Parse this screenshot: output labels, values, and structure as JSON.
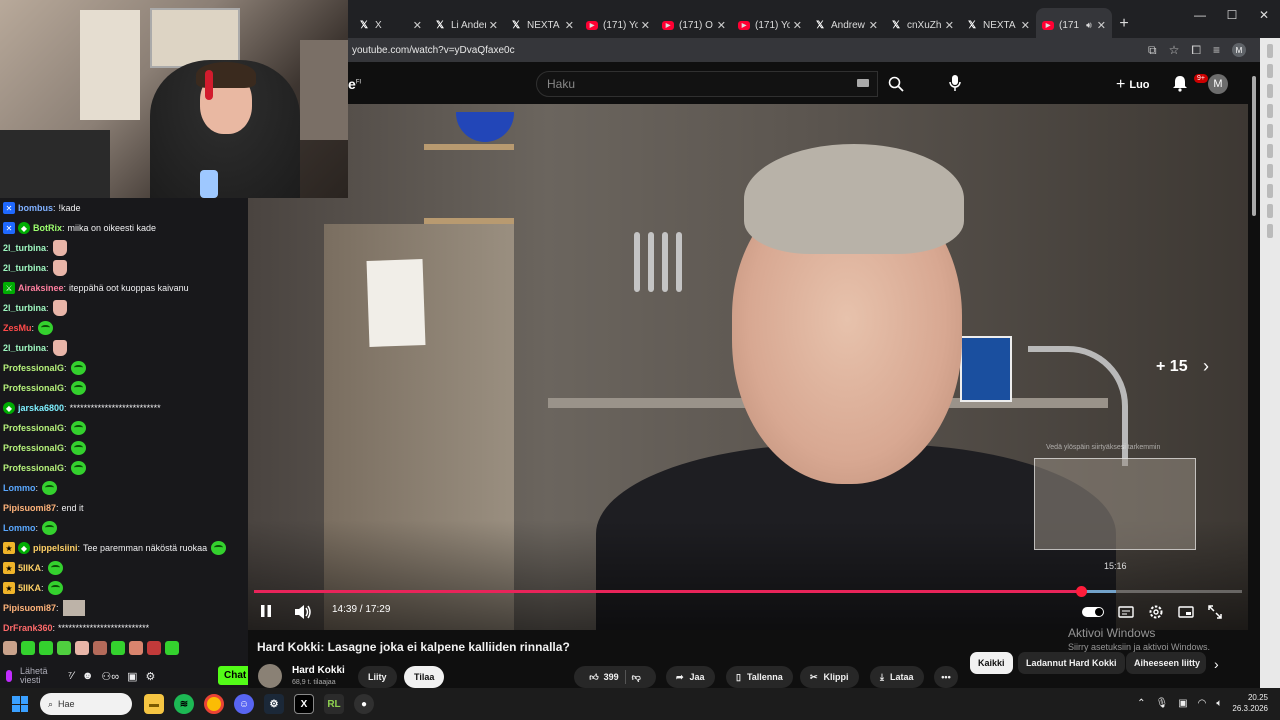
{
  "browser": {
    "tabs": [
      {
        "icon": "x-logo-icon",
        "title": "X",
        "active": false
      },
      {
        "icon": "x-logo-icon",
        "title": "Li Ander",
        "active": false
      },
      {
        "icon": "x-logo-icon",
        "title": "NEXTA",
        "active": false
      },
      {
        "icon": "youtube-icon",
        "title": "(171) Yo",
        "active": false
      },
      {
        "icon": "youtube-icon",
        "title": "(171) O",
        "active": false
      },
      {
        "icon": "youtube-icon",
        "title": "(171) Yo",
        "active": false
      },
      {
        "icon": "x-logo-icon",
        "title": "Andrew",
        "active": false
      },
      {
        "icon": "x-logo-icon",
        "title": "cnXuZh",
        "active": false
      },
      {
        "icon": "x-logo-icon",
        "title": "NEXTA",
        "active": false
      },
      {
        "icon": "youtube-icon",
        "title": "(171",
        "active": true
      }
    ],
    "url": "youtube.com/watch?v=yDvaQfaxe0c",
    "profile_initial": "M"
  },
  "youtube": {
    "logo_text": "e",
    "logo_region": "FI",
    "search_placeholder": "Haku",
    "create_label": "Luo",
    "notifications_badge": "9+",
    "avatar_initial": "M"
  },
  "chat": {
    "messages": [
      {
        "badges": [
          "bot"
        ],
        "user": "bombus",
        "color": "#7fb0ff",
        "text": "!kade",
        "emote": ""
      },
      {
        "badges": [
          "bot",
          "gift"
        ],
        "user": "BotRix",
        "color": "#9cff6e",
        "text": "miika on oikeesti kade",
        "emote": ""
      },
      {
        "badges": [],
        "user": "2l_turbina",
        "color": "#9ef7c0",
        "text": "",
        "emote": "hand"
      },
      {
        "badges": [],
        "user": "2l_turbina",
        "color": "#9ef7c0",
        "text": "",
        "emote": "hand"
      },
      {
        "badges": [
          "mod"
        ],
        "user": "Airaksinee",
        "color": "#ff7f9f",
        "text": "iteppähä oot kuoppas kaivanu",
        "emote": ""
      },
      {
        "badges": [],
        "user": "2l_turbina",
        "color": "#9ef7c0",
        "text": "",
        "emote": "hand"
      },
      {
        "badges": [],
        "user": "ZesMu",
        "color": "#ff4a4a",
        "text": "",
        "emote": "pepe"
      },
      {
        "badges": [],
        "user": "2l_turbina",
        "color": "#9ef7c0",
        "text": "",
        "emote": "hand"
      },
      {
        "badges": [],
        "user": "ProfessionalG",
        "color": "#b6f27c",
        "text": "",
        "emote": "pepe"
      },
      {
        "badges": [],
        "user": "ProfessionalG",
        "color": "#b6f27c",
        "text": "",
        "emote": "pepe"
      },
      {
        "badges": [
          "gift"
        ],
        "user": "jarska6800",
        "color": "#7ef0ff",
        "text": "**************************",
        "emote": ""
      },
      {
        "badges": [],
        "user": "ProfessionalG",
        "color": "#b6f27c",
        "text": "",
        "emote": "pepe"
      },
      {
        "badges": [],
        "user": "ProfessionalG",
        "color": "#b6f27c",
        "text": "",
        "emote": "pepe"
      },
      {
        "badges": [],
        "user": "ProfessionalG",
        "color": "#b6f27c",
        "text": "",
        "emote": "pepe"
      },
      {
        "badges": [],
        "user": "Lommo",
        "color": "#5aa8ff",
        "text": "",
        "emote": "pepe"
      },
      {
        "badges": [],
        "user": "Pipisuomi87",
        "color": "#ffb37a",
        "text": "end it",
        "emote": ""
      },
      {
        "badges": [],
        "user": "Lommo",
        "color": "#5aa8ff",
        "text": "",
        "emote": "pepe"
      },
      {
        "badges": [
          "sub",
          "gift"
        ],
        "user": "pippelsiini",
        "color": "#ffd166",
        "text": "Tee paremman näköstä ruokaa",
        "emote": "pepe"
      },
      {
        "badges": [
          "sub"
        ],
        "user": "5IIKA",
        "color": "#ffd166",
        "text": "",
        "emote": "pepe"
      },
      {
        "badges": [
          "sub"
        ],
        "user": "5IIKA",
        "color": "#ffd166",
        "text": "",
        "emote": "pepe"
      },
      {
        "badges": [],
        "user": "Pipisuomi87",
        "color": "#ffb37a",
        "text": "",
        "emote": "img"
      },
      {
        "badges": [],
        "user": "DrFrank360",
        "color": "#ff6a6a",
        "text": "**************************",
        "emote": ""
      }
    ],
    "input_placeholder": "Lähetä viesti",
    "send_label": "Chat"
  },
  "player": {
    "skip_label": "+ 15",
    "preview_hint": "Vedä ylöspäin siirtyäksesi tarkemmin",
    "preview_time": "15:16",
    "current_time": "14:39",
    "duration": "17:29",
    "time_display": "14:39 / 17:29",
    "progress_fraction": 0.837,
    "buffer_fraction": 0.872
  },
  "video": {
    "title": "Hard Kokki: Lasagne joka ei kalpene kalliiden rinnalla?",
    "channel": "Hard Kokki",
    "subscribers": "68,9 t. tilaajaa",
    "join_label": "Liity",
    "subscribe_label": "Tilaa",
    "likes": "399",
    "share_label": "Jaa",
    "save_label": "Tallenna",
    "clip_label": "Klippi",
    "download_label": "Lataa",
    "chips": [
      "Kaikki",
      "Ladannut Hard Kokki",
      "Aiheeseen liitty"
    ]
  },
  "windows": {
    "activate_title": "Aktivoi Windows",
    "activate_sub": "Siirry asetuksiin ja aktivoi Windows.",
    "search_label": "Hae",
    "time": "20.25",
    "date": "26.3.2026"
  },
  "colors": {
    "accent": "#ff0033",
    "progress": "#e8245a",
    "kick_green": "#53fc18"
  }
}
